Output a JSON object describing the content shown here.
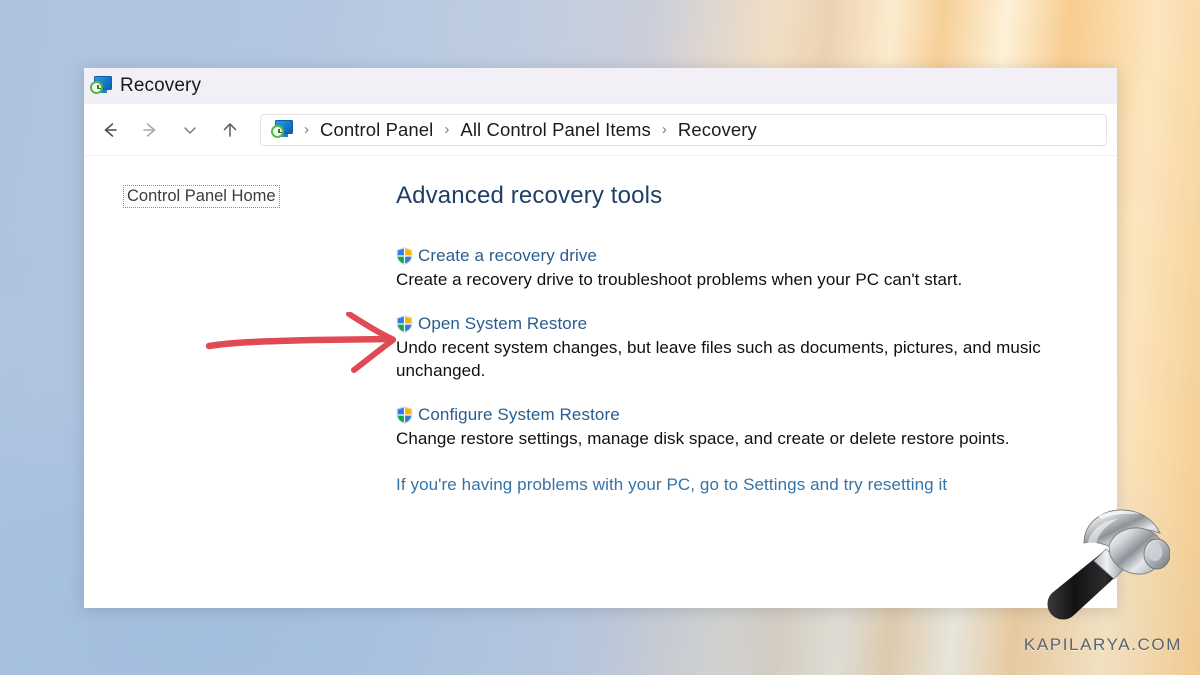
{
  "window": {
    "title": "Recovery",
    "title_icon": "recovery-icon"
  },
  "navigation": {
    "back_icon": "back-arrow-icon",
    "forward_icon": "forward-arrow-icon",
    "recent_icon": "chevron-down-icon",
    "up_icon": "up-arrow-icon",
    "address_icon": "recovery-icon",
    "separator": "›",
    "breadcrumbs": [
      {
        "label": "Control Panel"
      },
      {
        "label": "All Control Panel Items"
      },
      {
        "label": "Recovery"
      }
    ]
  },
  "sidebar": {
    "home_link": "Control Panel Home"
  },
  "content": {
    "heading": "Advanced recovery tools",
    "tools": [
      {
        "icon": "uac-shield-icon",
        "link": "Create a recovery drive",
        "description": "Create a recovery drive to troubleshoot problems when your PC can't start."
      },
      {
        "icon": "uac-shield-icon",
        "link": "Open System Restore",
        "description": "Undo recent system changes, but leave files such as documents, pictures, and music unchanged."
      },
      {
        "icon": "uac-shield-icon",
        "link": "Configure System Restore",
        "description": "Change restore settings, manage disk space, and create or delete restore points."
      }
    ],
    "footer_link": "If you're having problems with your PC, go to Settings and try resetting it"
  },
  "annotation": {
    "arrow_color": "#e04a54",
    "arrow_target": "Open System Restore"
  },
  "watermark": {
    "text": "KAPILARYA.COM",
    "icon": "hammer-icon"
  },
  "colors": {
    "link": "#2a5d8f",
    "heading": "#1f3f66",
    "footer_link": "#3573a8",
    "titlebar_bg": "#f2f0f6",
    "window_bg": "#ffffff"
  }
}
